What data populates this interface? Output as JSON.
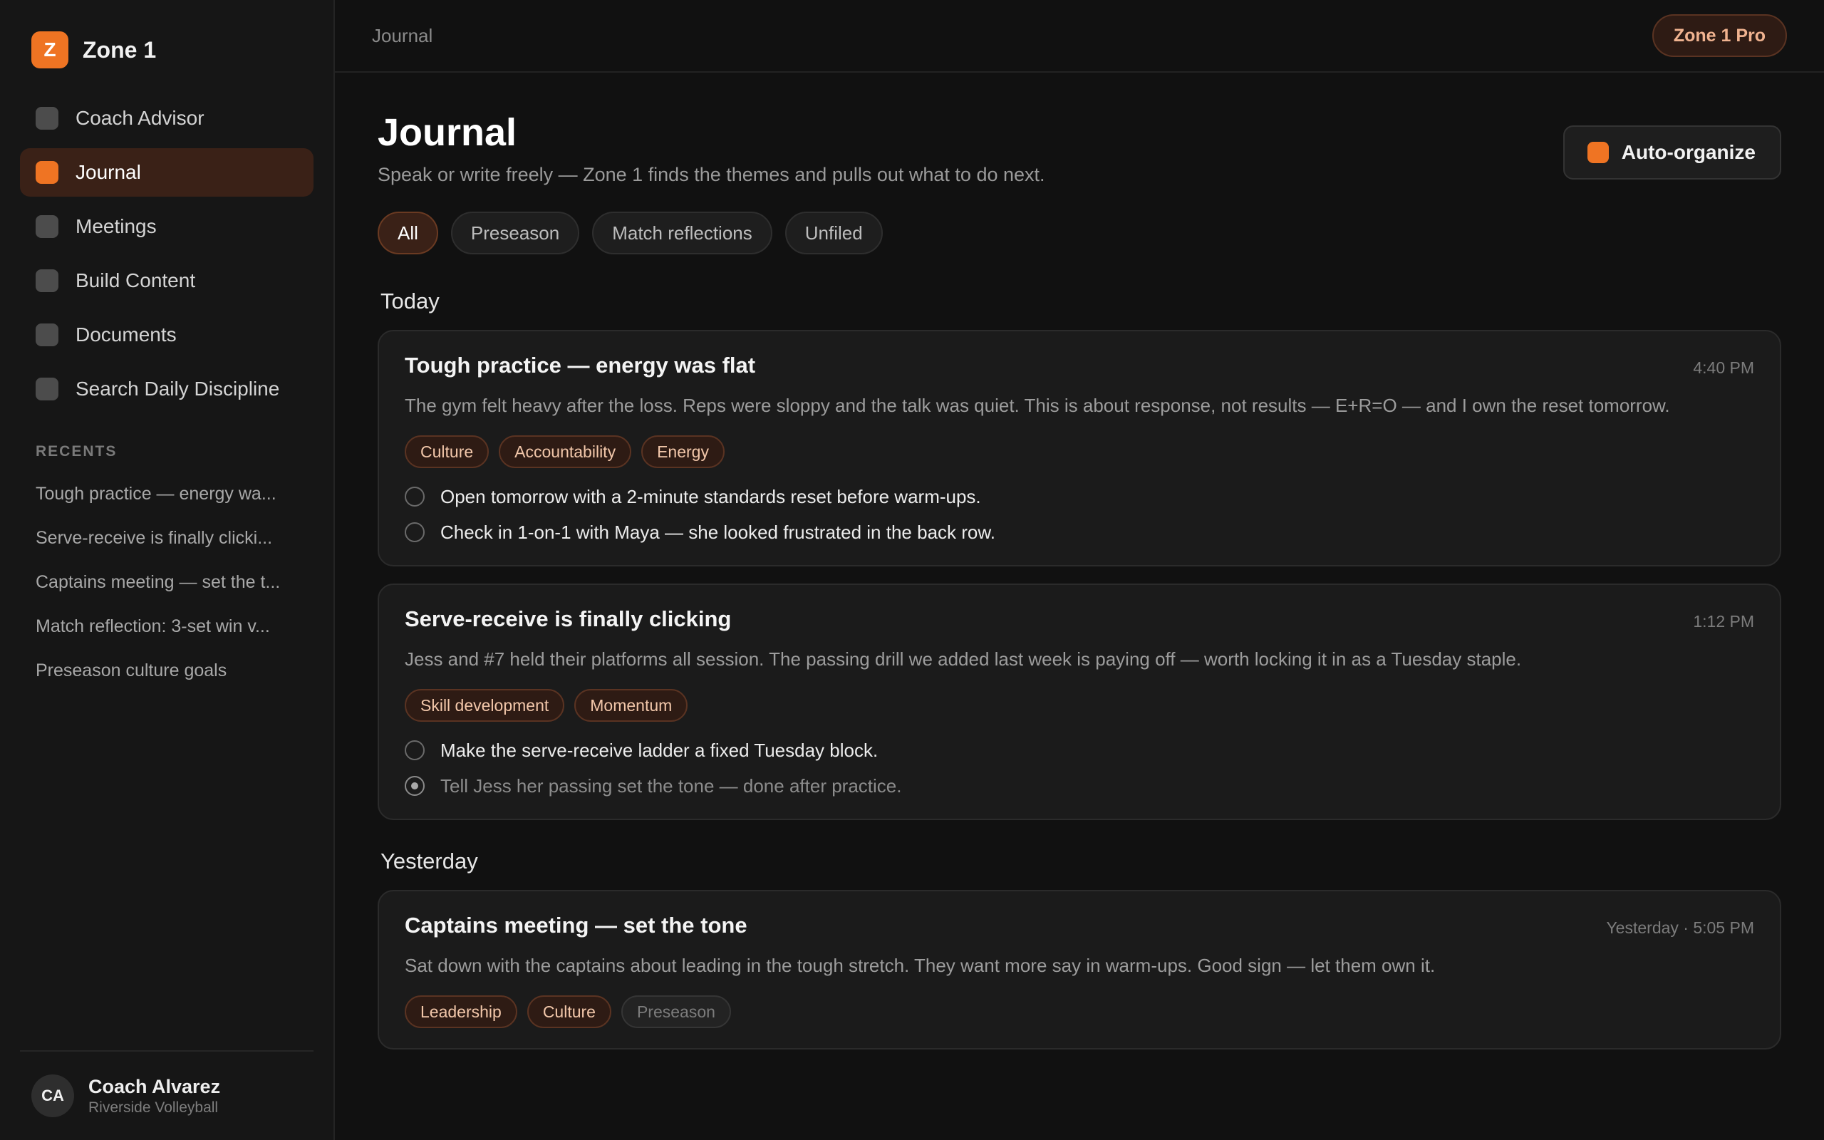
{
  "brand": {
    "logo_letter": "Z",
    "name": "Zone 1"
  },
  "nav": [
    {
      "label": "Coach Advisor",
      "active": false
    },
    {
      "label": "Journal",
      "active": true
    },
    {
      "label": "Meetings",
      "active": false
    },
    {
      "label": "Build Content",
      "active": false
    },
    {
      "label": "Documents",
      "active": false
    },
    {
      "label": "Search Daily Discipline",
      "active": false
    }
  ],
  "recents": {
    "label": "RECENTS",
    "items": [
      "Tough practice — energy wa...",
      "Serve-receive is finally clicki...",
      "Captains meeting — set the t...",
      "Match reflection: 3-set win v...",
      "Preseason culture goals"
    ]
  },
  "user": {
    "initials": "CA",
    "name": "Coach Alvarez",
    "team": "Riverside Volleyball"
  },
  "topbar": {
    "breadcrumb": "Journal",
    "badge": "Zone 1 Pro"
  },
  "page": {
    "title": "Journal",
    "subtitle": "Speak or write freely — Zone 1 finds the themes and pulls out what to do next.",
    "auto_button": "Auto-organize"
  },
  "filters": [
    {
      "label": "All",
      "active": true
    },
    {
      "label": "Preseason",
      "active": false
    },
    {
      "label": "Match reflections",
      "active": false
    },
    {
      "label": "Unfiled",
      "active": false
    }
  ],
  "sections": {
    "today": "Today",
    "yesterday": "Yesterday"
  },
  "entries": [
    {
      "title": "Tough practice — energy was flat",
      "time": "4:40 PM",
      "body": "The gym felt heavy after the loss. Reps were sloppy and the talk was quiet. This is about response, not results — E+R=O — and I own the reset tomorrow.",
      "tags": [
        "Culture",
        "Accountability",
        "Energy"
      ],
      "todos": [
        {
          "text": "Open tomorrow with a 2-minute standards reset before warm-ups.",
          "done": false
        },
        {
          "text": "Check in 1-on-1 with Maya — she looked frustrated in the back row.",
          "done": false
        }
      ]
    },
    {
      "title": "Serve-receive is finally clicking",
      "time": "1:12 PM",
      "body": "Jess and #7 held their platforms all session. The passing drill we added last week is paying off — worth locking it in as a Tuesday staple.",
      "tags": [
        "Skill development",
        "Momentum"
      ],
      "todos": [
        {
          "text": "Make the serve-receive ladder a fixed Tuesday block.",
          "done": false
        },
        {
          "text": "Tell Jess her passing set the tone — done after practice.",
          "done": true
        }
      ]
    },
    {
      "title": "Captains meeting — set the tone",
      "time": "Yesterday · 5:05 PM",
      "body": "Sat down with the captains about leading in the tough stretch. They want more say in warm-ups. Good sign — let them own it.",
      "tags": [
        "Leadership",
        "Culture",
        "Preseason"
      ]
    }
  ],
  "colors": {
    "accent": "#ef7423",
    "background": "#111111",
    "sidebar": "#161616",
    "card": "#1b1b1b"
  }
}
